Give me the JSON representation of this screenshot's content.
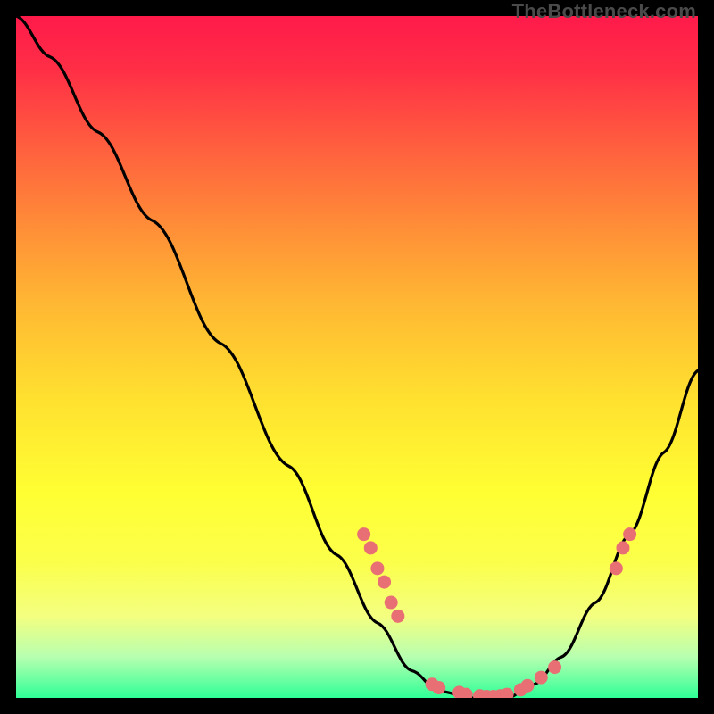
{
  "attribution": "TheBottleneck.com",
  "chart_data": {
    "type": "line",
    "title": "",
    "xlabel": "",
    "ylabel": "",
    "xlim": [
      0,
      100
    ],
    "ylim": [
      0,
      100
    ],
    "curve": [
      {
        "x": 0,
        "y": 100
      },
      {
        "x": 5,
        "y": 94
      },
      {
        "x": 12,
        "y": 83
      },
      {
        "x": 20,
        "y": 70
      },
      {
        "x": 30,
        "y": 52
      },
      {
        "x": 40,
        "y": 34
      },
      {
        "x": 47,
        "y": 21
      },
      {
        "x": 53,
        "y": 11
      },
      {
        "x": 58,
        "y": 4
      },
      {
        "x": 62,
        "y": 1
      },
      {
        "x": 67,
        "y": 0
      },
      {
        "x": 72,
        "y": 0
      },
      {
        "x": 76,
        "y": 2
      },
      {
        "x": 80,
        "y": 6
      },
      {
        "x": 85,
        "y": 14
      },
      {
        "x": 90,
        "y": 24
      },
      {
        "x": 95,
        "y": 36
      },
      {
        "x": 100,
        "y": 48
      }
    ],
    "markers": [
      {
        "x": 51,
        "y": 24
      },
      {
        "x": 52,
        "y": 22
      },
      {
        "x": 53,
        "y": 19
      },
      {
        "x": 54,
        "y": 17
      },
      {
        "x": 55,
        "y": 14
      },
      {
        "x": 56,
        "y": 12
      },
      {
        "x": 61,
        "y": 2
      },
      {
        "x": 62,
        "y": 1.5
      },
      {
        "x": 65,
        "y": 0.8
      },
      {
        "x": 66,
        "y": 0.5
      },
      {
        "x": 68,
        "y": 0.3
      },
      {
        "x": 69,
        "y": 0.2
      },
      {
        "x": 70,
        "y": 0.2
      },
      {
        "x": 71,
        "y": 0.3
      },
      {
        "x": 72,
        "y": 0.5
      },
      {
        "x": 74,
        "y": 1.2
      },
      {
        "x": 75,
        "y": 1.8
      },
      {
        "x": 77,
        "y": 3
      },
      {
        "x": 79,
        "y": 4.5
      },
      {
        "x": 88,
        "y": 19
      },
      {
        "x": 89,
        "y": 22
      },
      {
        "x": 90,
        "y": 24
      }
    ],
    "marker_color": "#e86f74",
    "curve_color": "#000000"
  }
}
